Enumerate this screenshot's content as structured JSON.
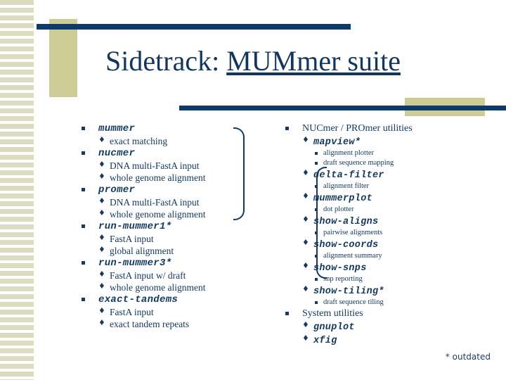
{
  "slide": {
    "title_prefix": "Sidetrack: ",
    "title_main": "MUMmer suite",
    "footnote": "* outdated"
  },
  "colors": {
    "navy": "#0c3a69",
    "text_navy": "#15395f",
    "khaki": "#cdcb96",
    "stripe": "#dedcc0",
    "background": "#ffffff"
  },
  "left_column": [
    {
      "label": "mummer",
      "style": "mono",
      "children": [
        {
          "label": "exact matching",
          "style": "plain"
        }
      ]
    },
    {
      "label": "nucmer",
      "style": "mono",
      "children": [
        {
          "label": "DNA multi-FastA input",
          "style": "plain"
        },
        {
          "label": "whole genome alignment",
          "style": "plain"
        }
      ]
    },
    {
      "label": "promer",
      "style": "mono",
      "children": [
        {
          "label": "DNA multi-FastA input",
          "style": "plain"
        },
        {
          "label": "whole genome alignment",
          "style": "plain"
        }
      ]
    },
    {
      "label": "run-mummer1*",
      "style": "mono",
      "children": [
        {
          "label": "FastA input",
          "style": "plain"
        },
        {
          "label": "global alignment",
          "style": "plain"
        }
      ]
    },
    {
      "label": "run-mummer3*",
      "style": "mono",
      "children": [
        {
          "label": "FastA input w/ draft",
          "style": "plain"
        },
        {
          "label": "whole genome alignment",
          "style": "plain"
        }
      ]
    },
    {
      "label": "exact-tandems",
      "style": "mono",
      "children": [
        {
          "label": "FastA input",
          "style": "plain"
        },
        {
          "label": "exact tandem repeats",
          "style": "plain"
        }
      ]
    }
  ],
  "right_column": [
    {
      "label": "NUCmer / PROmer utilities",
      "style": "plain",
      "children": [
        {
          "label": "mapview*",
          "style": "mono",
          "children": [
            {
              "label": "alignment plotter",
              "style": "plain"
            },
            {
              "label": "draft sequence mapping",
              "style": "plain"
            }
          ]
        },
        {
          "label": "delta-filter",
          "style": "mono",
          "children": [
            {
              "label": "alignment filter",
              "style": "plain"
            }
          ]
        },
        {
          "label": "mummerplot",
          "style": "mono",
          "children": [
            {
              "label": "dot plotter",
              "style": "plain"
            }
          ]
        },
        {
          "label": "show-aligns",
          "style": "mono",
          "children": [
            {
              "label": "pairwise alignments",
              "style": "plain"
            }
          ]
        },
        {
          "label": "show-coords",
          "style": "mono",
          "children": [
            {
              "label": "alignment summary",
              "style": "plain"
            }
          ]
        },
        {
          "label": "show-snps",
          "style": "mono",
          "children": [
            {
              "label": "snp reporting",
              "style": "plain"
            }
          ]
        },
        {
          "label": "show-tiling*",
          "style": "mono",
          "children": [
            {
              "label": "draft sequence tiling",
              "style": "plain"
            }
          ]
        }
      ]
    },
    {
      "label": "System utilities",
      "style": "plain",
      "children": [
        {
          "label": "gnuplot",
          "style": "mono"
        },
        {
          "label": "xfig",
          "style": "mono"
        }
      ]
    }
  ],
  "bullets": {
    "level1_glyph": "square",
    "level2_glyph": "♦",
    "level3_glyph": "small-square"
  }
}
